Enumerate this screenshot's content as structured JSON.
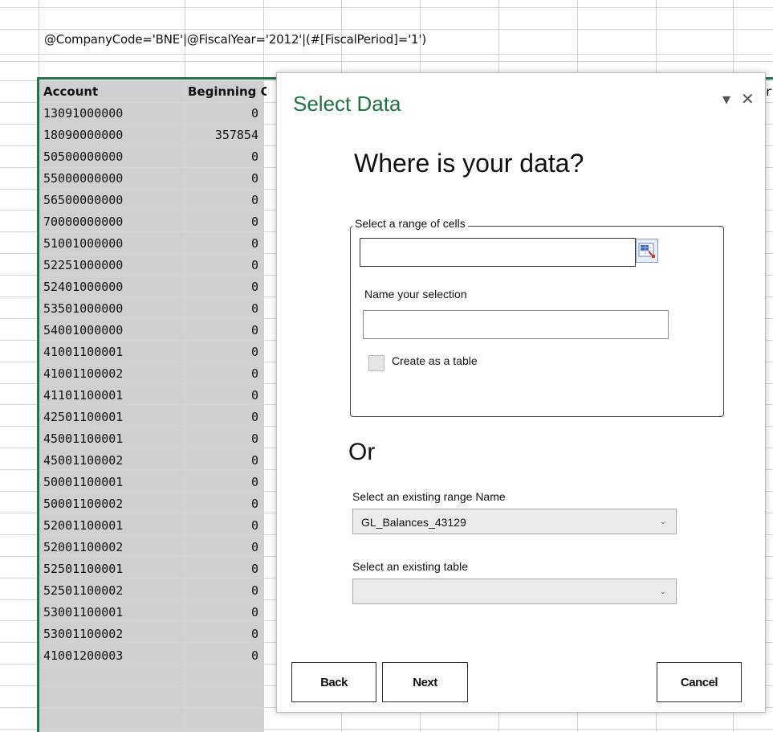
{
  "formula_bar_text": "@CompanyCode='BNE'|@FiscalYear='2012'|(#[FiscalPeriod]='1')",
  "sheet": {
    "header_account": "Account",
    "header_beginning": "Beginning C",
    "right_edge_char": "r",
    "rows": [
      {
        "account": "13091000000",
        "beginning": "0"
      },
      {
        "account": "18090000000",
        "beginning": "357854"
      },
      {
        "account": "50500000000",
        "beginning": "0"
      },
      {
        "account": "55000000000",
        "beginning": "0"
      },
      {
        "account": "56500000000",
        "beginning": "0"
      },
      {
        "account": "70000000000",
        "beginning": "0"
      },
      {
        "account": "51001000000",
        "beginning": "0"
      },
      {
        "account": "52251000000",
        "beginning": "0"
      },
      {
        "account": "52401000000",
        "beginning": "0"
      },
      {
        "account": "53501000000",
        "beginning": "0"
      },
      {
        "account": "54001000000",
        "beginning": "0"
      },
      {
        "account": "41001100001",
        "beginning": "0"
      },
      {
        "account": "41001100002",
        "beginning": "0"
      },
      {
        "account": "41101100001",
        "beginning": "0"
      },
      {
        "account": "42501100001",
        "beginning": "0"
      },
      {
        "account": "45001100001",
        "beginning": "0"
      },
      {
        "account": "45001100002",
        "beginning": "0"
      },
      {
        "account": "50001100001",
        "beginning": "0"
      },
      {
        "account": "50001100002",
        "beginning": "0"
      },
      {
        "account": "52001100001",
        "beginning": "0"
      },
      {
        "account": "52001100002",
        "beginning": "0"
      },
      {
        "account": "52501100001",
        "beginning": "0"
      },
      {
        "account": "52501100002",
        "beginning": "0"
      },
      {
        "account": "53001100001",
        "beginning": "0"
      },
      {
        "account": "53001100002",
        "beginning": "0"
      },
      {
        "account": "41001200003",
        "beginning": "0"
      }
    ]
  },
  "dialog": {
    "title": "Select Data",
    "dropdown_glyph": "▾",
    "close_glyph": "✕",
    "heading": "Where is your data?",
    "range_group_label": "Select a range of cells",
    "range_input_value": "",
    "name_label": "Name your selection",
    "name_input_value": "",
    "create_table_label": "Create as a table",
    "create_table_checked": false,
    "or_label": "Or",
    "existing_range_label": "Select an existing range Name",
    "existing_range_value": "GL_Balances_43129",
    "existing_table_label": "Select an existing table",
    "existing_table_value": "",
    "back_label": "Back",
    "next_label": "Next",
    "cancel_label": "Cancel",
    "accent_color": "#217346"
  }
}
